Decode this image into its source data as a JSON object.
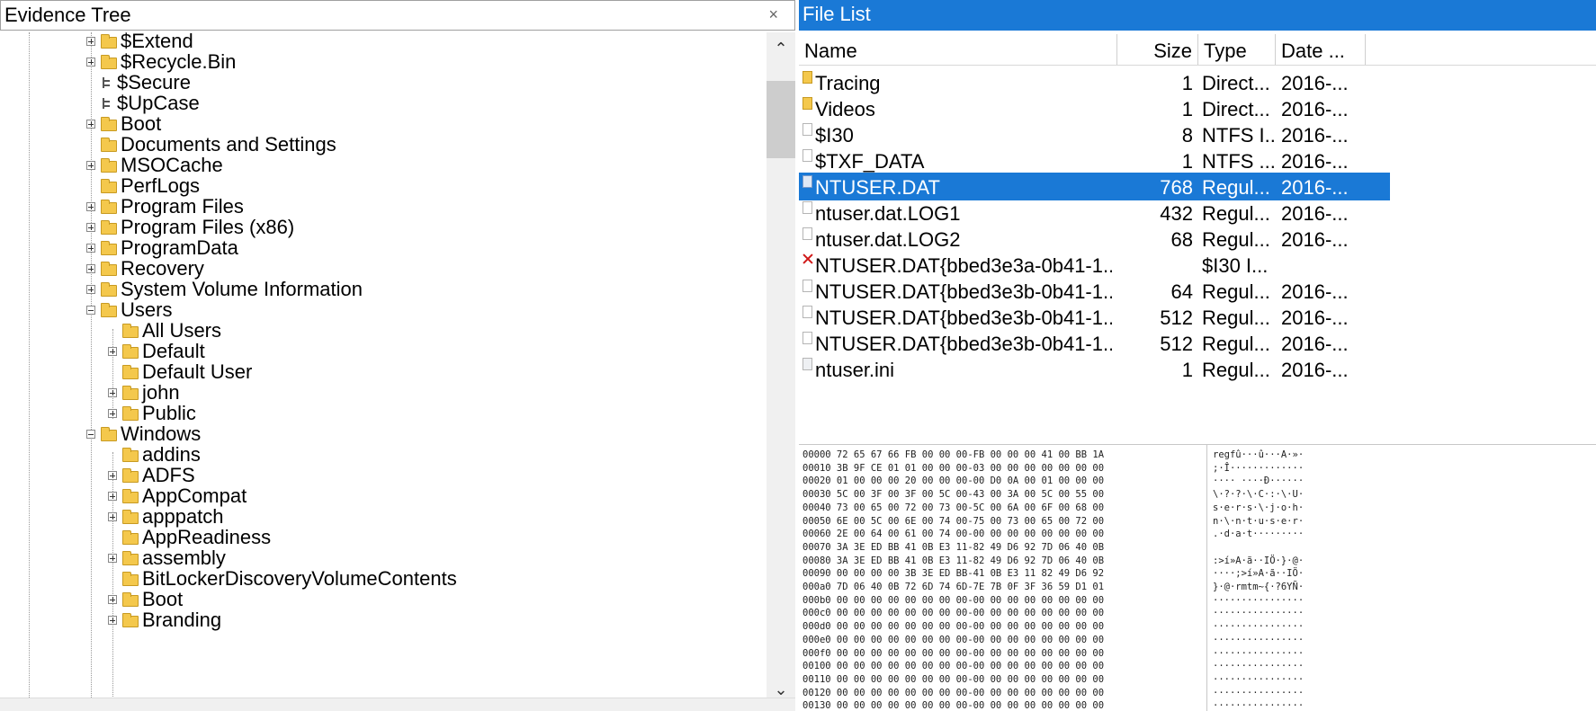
{
  "left_pane": {
    "title": "Evidence Tree",
    "close": "×",
    "scroll_up": "⌃",
    "scroll_down": "⌄"
  },
  "tree": [
    {
      "label": "$Extend",
      "twisty": "plus",
      "icon": "folder"
    },
    {
      "label": "$Recycle.Bin",
      "twisty": "plus",
      "icon": "folder"
    },
    {
      "label": "$Secure",
      "twisty": "none",
      "icon": "file"
    },
    {
      "label": "$UpCase",
      "twisty": "none",
      "icon": "file"
    },
    {
      "label": "Boot",
      "twisty": "plus",
      "icon": "folder"
    },
    {
      "label": "Documents and Settings",
      "twisty": "none",
      "icon": "folder"
    },
    {
      "label": "MSOCache",
      "twisty": "plus",
      "icon": "folder"
    },
    {
      "label": "PerfLogs",
      "twisty": "none",
      "icon": "folder"
    },
    {
      "label": "Program Files",
      "twisty": "plus",
      "icon": "folder"
    },
    {
      "label": "Program Files (x86)",
      "twisty": "plus",
      "icon": "folder"
    },
    {
      "label": "ProgramData",
      "twisty": "plus",
      "icon": "folder"
    },
    {
      "label": "Recovery",
      "twisty": "plus",
      "icon": "folder"
    },
    {
      "label": "System Volume Information",
      "twisty": "plus",
      "icon": "folder"
    },
    {
      "label": "Users",
      "twisty": "minus",
      "icon": "folder"
    },
    {
      "label": "All Users",
      "twisty": "none",
      "icon": "folder"
    },
    {
      "label": "Default",
      "twisty": "plus",
      "icon": "folder"
    },
    {
      "label": "Default User",
      "twisty": "none",
      "icon": "folder"
    },
    {
      "label": "john",
      "twisty": "plus",
      "icon": "folder"
    },
    {
      "label": "Public",
      "twisty": "plus",
      "icon": "folder"
    },
    {
      "label": "Windows",
      "twisty": "minus",
      "icon": "folder"
    },
    {
      "label": "addins",
      "twisty": "none",
      "icon": "folder"
    },
    {
      "label": "ADFS",
      "twisty": "plus",
      "icon": "folder"
    },
    {
      "label": "AppCompat",
      "twisty": "plus",
      "icon": "folder"
    },
    {
      "label": "apppatch",
      "twisty": "plus",
      "icon": "folder"
    },
    {
      "label": "AppReadiness",
      "twisty": "none",
      "icon": "folder"
    },
    {
      "label": "assembly",
      "twisty": "plus",
      "icon": "folder"
    },
    {
      "label": "BitLockerDiscoveryVolumeContents",
      "twisty": "none",
      "icon": "folder"
    },
    {
      "label": "Boot",
      "twisty": "plus",
      "icon": "folder"
    },
    {
      "label": "Branding",
      "twisty": "plus",
      "icon": "folder"
    }
  ],
  "right_pane": {
    "title": "File List",
    "columns": {
      "name": "Name",
      "size": "Size",
      "type": "Type",
      "date": "Date ..."
    }
  },
  "files": [
    {
      "name": "Tracing",
      "size": "1",
      "type": "Direct...",
      "date": "2016-...",
      "icon": "folder"
    },
    {
      "name": "Videos",
      "size": "1",
      "type": "Direct...",
      "date": "2016-...",
      "icon": "folder"
    },
    {
      "name": "$I30",
      "size": "8",
      "type": "NTFS I...",
      "date": "2016-...",
      "icon": "file"
    },
    {
      "name": "$TXF_DATA",
      "size": "1",
      "type": "NTFS ...",
      "date": "2016-...",
      "icon": "file"
    },
    {
      "name": "NTUSER.DAT",
      "size": "768",
      "type": "Regul...",
      "date": "2016-...",
      "icon": "registry",
      "selected": true
    },
    {
      "name": "ntuser.dat.LOG1",
      "size": "432",
      "type": "Regul...",
      "date": "2016-...",
      "icon": "file"
    },
    {
      "name": "ntuser.dat.LOG2",
      "size": "68",
      "type": "Regul...",
      "date": "2016-...",
      "icon": "file"
    },
    {
      "name": "NTUSER.DAT{bbed3e3a-0b41-1...",
      "size": "",
      "type": "$I30 I...",
      "date": "",
      "icon": "deleted"
    },
    {
      "name": "NTUSER.DAT{bbed3e3b-0b41-1...",
      "size": "64",
      "type": "Regul...",
      "date": "2016-...",
      "icon": "file"
    },
    {
      "name": "NTUSER.DAT{bbed3e3b-0b41-1...",
      "size": "512",
      "type": "Regul...",
      "date": "2016-...",
      "icon": "file"
    },
    {
      "name": "NTUSER.DAT{bbed3e3b-0b41-1...",
      "size": "512",
      "type": "Regul...",
      "date": "2016-...",
      "icon": "file"
    },
    {
      "name": "ntuser.ini",
      "size": "1",
      "type": "Regul...",
      "date": "2016-...",
      "icon": "ini"
    }
  ],
  "hex": [
    {
      "hex": "00000 72 65 67 66 FB 00 00 00-FB 00 00 00 41 00 BB 1A",
      "ascii": "regfû···û···A·»·"
    },
    {
      "hex": "00010 3B 9F CE 01 01 00 00 00-03 00 00 00 00 00 00 00",
      "ascii": ";·Î·············"
    },
    {
      "hex": "00020 01 00 00 00 20 00 00 00-00 D0 0A 00 01 00 00 00",
      "ascii": "···· ····Ð······"
    },
    {
      "hex": "00030 5C 00 3F 00 3F 00 5C 00-43 00 3A 00 5C 00 55 00",
      "ascii": "\\·?·?·\\·C·:·\\·U·"
    },
    {
      "hex": "00040 73 00 65 00 72 00 73 00-5C 00 6A 00 6F 00 68 00",
      "ascii": "s·e·r·s·\\·j·o·h·"
    },
    {
      "hex": "00050 6E 00 5C 00 6E 00 74 00-75 00 73 00 65 00 72 00",
      "ascii": "n·\\·n·t·u·s·e·r·"
    },
    {
      "hex": "00060 2E 00 64 00 61 00 74 00-00 00 00 00 00 00 00 00",
      "ascii": ".·d·a·t·········"
    },
    {
      "hex": "00070 3A 3E ED BB 41 0B E3 11-82 49 D6 92 7D 06 40 0B",
      ":ascii": ""
    },
    {
      "hex": "00080 3A 3E ED BB 41 0B E3 11-82 49 D6 92 7D 06 40 0B",
      "ascii": ":>í»A·ã··IÖ·}·@·"
    },
    {
      "hex": "00090 00 00 00 00 3B 3E ED BB-41 0B E3 11 82 49 D6 92",
      "ascii": "····;>í»A·ã··IÖ·"
    },
    {
      "hex": "000a0 7D 06 40 0B 72 6D 74 6D-7E 7B 0F 3F 36 59 D1 01",
      "ascii": "}·@·rmtm~{·?6YÑ·"
    },
    {
      "hex": "000b0 00 00 00 00 00 00 00 00-00 00 00 00 00 00 00 00",
      "ascii": "················"
    },
    {
      "hex": "000c0 00 00 00 00 00 00 00 00-00 00 00 00 00 00 00 00",
      "ascii": "················"
    },
    {
      "hex": "000d0 00 00 00 00 00 00 00 00-00 00 00 00 00 00 00 00",
      "ascii": "················"
    },
    {
      "hex": "000e0 00 00 00 00 00 00 00 00-00 00 00 00 00 00 00 00",
      "ascii": "················"
    },
    {
      "hex": "000f0 00 00 00 00 00 00 00 00-00 00 00 00 00 00 00 00",
      "ascii": "················"
    },
    {
      "hex": "00100 00 00 00 00 00 00 00 00-00 00 00 00 00 00 00 00",
      "ascii": "················"
    },
    {
      "hex": "00110 00 00 00 00 00 00 00 00-00 00 00 00 00 00 00 00",
      "ascii": "················"
    },
    {
      "hex": "00120 00 00 00 00 00 00 00 00-00 00 00 00 00 00 00 00",
      "ascii": "················"
    },
    {
      "hex": "00130 00 00 00 00 00 00 00 00-00 00 00 00 00 00 00 00",
      "ascii": "················"
    }
  ]
}
